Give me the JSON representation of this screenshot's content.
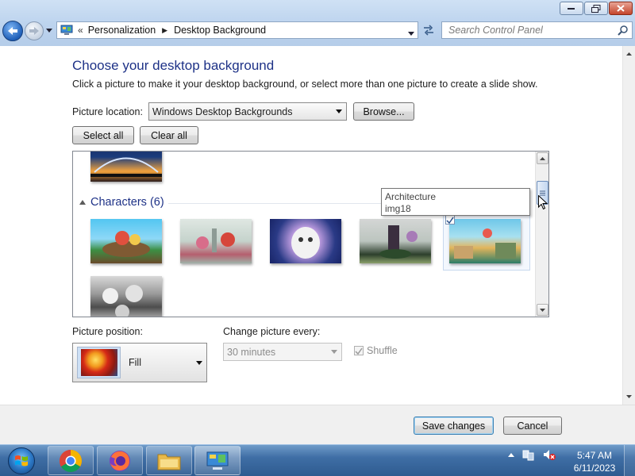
{
  "window": {
    "controls": [
      "minimize",
      "maximize",
      "close"
    ]
  },
  "address": {
    "crumb_sep": "«",
    "crumbs": [
      "Personalization",
      "Desktop Background"
    ],
    "crumb_arrow": "▶"
  },
  "search": {
    "placeholder": "Search Control Panel"
  },
  "main": {
    "title": "Choose your desktop background",
    "description": "Click a picture to make it your desktop background, or select more than one picture to create a slide show.",
    "location_label": "Picture location:",
    "location_value": "Windows Desktop Backgrounds",
    "browse_label": "Browse...",
    "select_all_label": "Select all",
    "clear_all_label": "Clear all"
  },
  "gallery": {
    "section_title": "Characters (6)",
    "thumbnails": [
      "Characters image 1",
      "Characters image 2",
      "Characters image 3",
      "Characters image 4",
      "Characters image 5",
      "Characters image 6"
    ],
    "selected_index": 4,
    "tooltip": {
      "line1": "Architecture",
      "line2": "img18"
    }
  },
  "options": {
    "position_label": "Picture position:",
    "position_value": "Fill",
    "change_label": "Change picture every:",
    "change_value": "30 minutes",
    "shuffle_label": "Shuffle",
    "shuffle_checked": true
  },
  "footer": {
    "save_label": "Save changes",
    "cancel_label": "Cancel"
  },
  "taskbar": {
    "apps": [
      "chrome-icon",
      "firefox-icon",
      "folder-icon",
      "control-panel-icon"
    ],
    "time": "5:47 AM",
    "date": "6/11/2023"
  },
  "colors": {
    "title_blue": "#1e3287",
    "taskbar": "#3f6ea5"
  }
}
